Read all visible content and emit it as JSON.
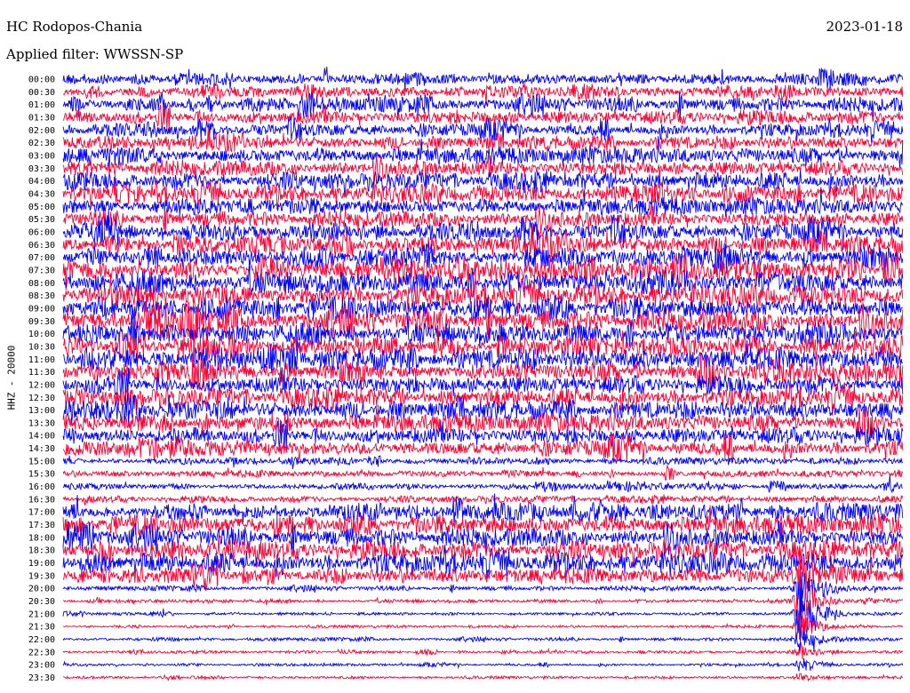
{
  "header": {
    "station": "HC Rodopos-Chania",
    "date": "2023-01-18",
    "filter": "Applied filter: WWSSN-SP"
  },
  "chart_data": {
    "type": "line",
    "ylabel": "HHZ - 20000",
    "time_labels": [
      "00:00",
      "00:30",
      "01:00",
      "01:30",
      "02:00",
      "02:30",
      "03:00",
      "03:30",
      "04:00",
      "04:30",
      "05:00",
      "05:30",
      "06:00",
      "06:30",
      "07:00",
      "07:30",
      "08:00",
      "08:30",
      "09:00",
      "09:30",
      "10:00",
      "10:30",
      "11:00",
      "11:30",
      "12:00",
      "12:30",
      "13:00",
      "13:30",
      "14:00",
      "14:30",
      "15:00",
      "15:30",
      "16:00",
      "16:30",
      "17:00",
      "17:30",
      "18:00",
      "18:30",
      "19:00",
      "19:30",
      "20:00",
      "20:30",
      "21:00",
      "21:30",
      "22:00",
      "22:30",
      "23:00",
      "23:30"
    ],
    "series_colors": [
      "#0000ff",
      "#ff0033"
    ],
    "noise_amplitude": [
      0.9,
      1.0,
      1.1,
      1.1,
      1.0,
      1.0,
      1.2,
      1.2,
      1.3,
      1.3,
      1.2,
      1.2,
      1.3,
      1.4,
      1.5,
      1.5,
      1.6,
      1.6,
      1.6,
      1.6,
      1.5,
      1.5,
      1.6,
      1.5,
      1.4,
      1.4,
      1.4,
      1.3,
      1.3,
      1.2,
      0.5,
      0.5,
      0.45,
      0.5,
      1.3,
      1.4,
      1.4,
      1.4,
      1.5,
      1.2,
      0.35,
      0.25,
      0.2,
      0.2,
      0.25,
      0.2,
      0.2,
      0.2
    ],
    "events": [
      {
        "trace": 39,
        "position": 0.875,
        "amplitude": 5.0
      },
      {
        "trace": 40,
        "position": 0.875,
        "amplitude": 4.5
      },
      {
        "trace": 41,
        "position": 0.875,
        "amplitude": 6.5
      },
      {
        "trace": 42,
        "position": 0.875,
        "amplitude": 7.0
      },
      {
        "trace": 43,
        "position": 0.875,
        "amplitude": 4.0
      },
      {
        "trace": 44,
        "position": 0.875,
        "amplitude": 3.0
      },
      {
        "trace": 45,
        "position": 0.875,
        "amplitude": 2.0
      },
      {
        "trace": 46,
        "position": 0.875,
        "amplitude": 1.5
      },
      {
        "trace": 47,
        "position": 0.875,
        "amplitude": 1.0
      },
      {
        "trace": 41,
        "position": 0.955,
        "amplitude": 0.6
      }
    ]
  }
}
